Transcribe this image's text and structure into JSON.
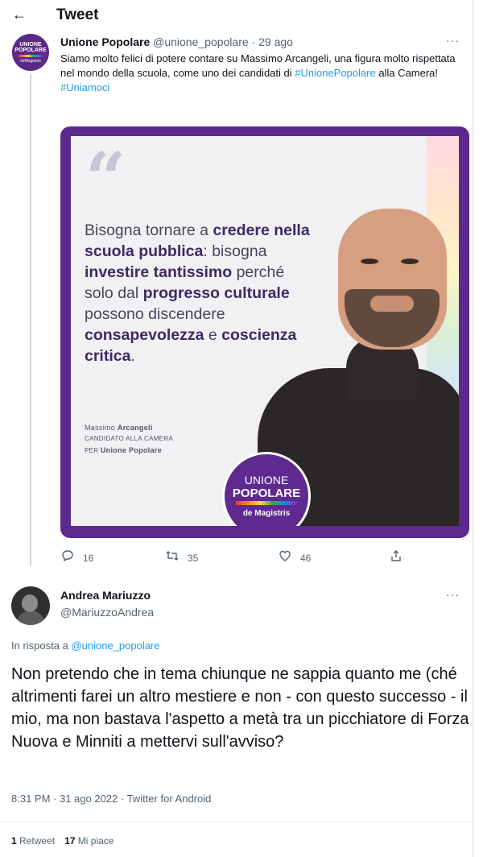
{
  "header": {
    "back_icon": "←",
    "title": "Tweet"
  },
  "tweet1": {
    "avatar": {
      "line1": "UNIONE",
      "line2": "POPOLARE",
      "line3": "deMagistris"
    },
    "name": "Unione Popolare",
    "handle": "@unione_popolare",
    "separator": "·",
    "time": "29 ago",
    "more_icon": "···",
    "text_part1": "Siamo molto felici di potere contare su Massimo Arcangeli, una figura molto rispettata nel mondo della scuola, come uno dei candidati di ",
    "hashtag1": "#UnionePopolare",
    "text_part2": " alla Camera!",
    "hashtag2": "#Uniamoci",
    "media": {
      "quote_mark": "“",
      "quote_segments": [
        {
          "t": "Bisogna tornare a ",
          "b": false
        },
        {
          "t": "credere nella scuola pubblica",
          "b": true
        },
        {
          "t": ": bisogna ",
          "b": false
        },
        {
          "t": "investire tantissimo",
          "b": true
        },
        {
          "t": " perché solo dal ",
          "b": false
        },
        {
          "t": "progresso culturale",
          "b": true
        },
        {
          "t": " possono discendere ",
          "b": false
        },
        {
          "t": "consapevolezza",
          "b": true
        },
        {
          "t": " e ",
          "b": false
        },
        {
          "t": "coscienza critica",
          "b": true
        },
        {
          "t": ".",
          "b": false
        }
      ],
      "sig_first": "Massimo ",
      "sig_last": "Arcangeli",
      "sig_role": "candidato alla camera",
      "sig_party_prefix": "per ",
      "sig_party": "Unione Popolare",
      "badge": {
        "l1": "UNIONE",
        "l2": "POPOLARE",
        "l3": "de Magistris"
      }
    },
    "actions": {
      "reply": {
        "icon": "comment-icon",
        "count": "16"
      },
      "retweet": {
        "icon": "retweet-icon",
        "count": "35"
      },
      "like": {
        "icon": "heart-icon",
        "count": "46"
      },
      "share": {
        "icon": "share-icon"
      }
    }
  },
  "tweet2": {
    "name": "Andrea Mariuzzo",
    "handle": "@MariuzzoAndrea",
    "more_icon": "···",
    "reply_prefix": "In risposta a ",
    "reply_handle": "@unione_popolare",
    "text": "Non pretendo che in tema chiunque ne sappia quanto me (ché altrimenti farei un altro mestiere e non - con questo successo - il mio, ma non bastava l'aspetto a metà tra un picchiatore di Forza Nuova e Minniti a mettervi sull'avviso?",
    "meta": "8:31 PM · 31 ago 2022 · Twitter for Android",
    "retweets_count": "1",
    "retweets_label": "Retweet",
    "likes_count": "17",
    "likes_label": "Mi piace"
  },
  "colors": {
    "link": "#1d9bf0",
    "muted": "#536471",
    "brand_purple": "#5b2a8c"
  }
}
